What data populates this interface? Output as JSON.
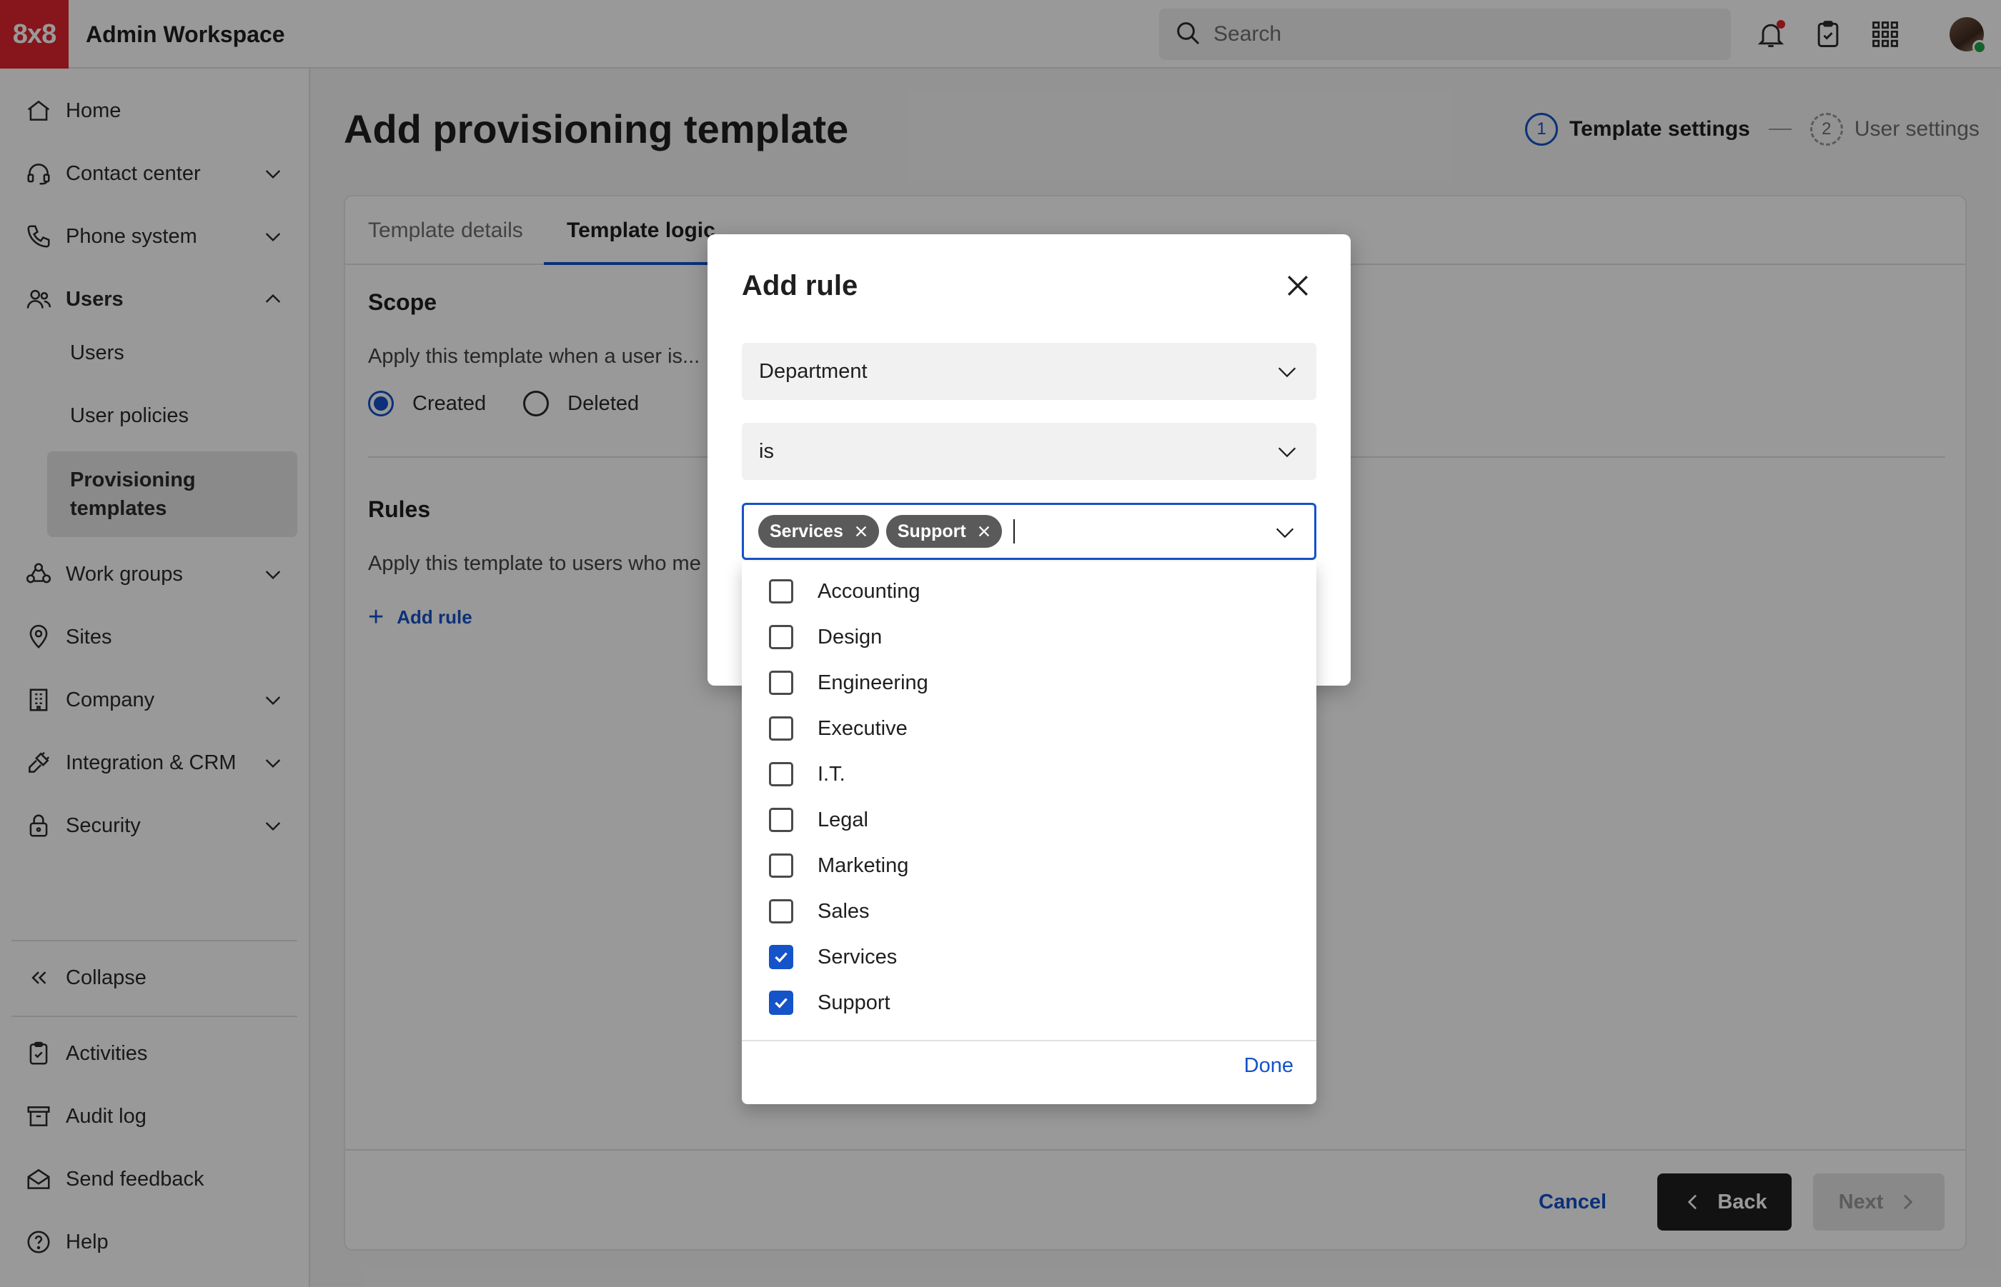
{
  "app": {
    "logo": "8x8",
    "title": "Admin Workspace"
  },
  "search": {
    "placeholder": "Search"
  },
  "sidebar": {
    "items": [
      {
        "label": "Home"
      },
      {
        "label": "Contact center"
      },
      {
        "label": "Phone system"
      },
      {
        "label": "Users"
      },
      {
        "label": "Work groups"
      },
      {
        "label": "Sites"
      },
      {
        "label": "Company"
      },
      {
        "label": "Integration & CRM"
      },
      {
        "label": "Security"
      }
    ],
    "users_sub": [
      {
        "label": "Users"
      },
      {
        "label": "User policies"
      },
      {
        "label": "Provisioning templates"
      }
    ],
    "bottom": [
      {
        "label": "Collapse"
      },
      {
        "label": "Activities"
      },
      {
        "label": "Audit log"
      },
      {
        "label": "Send feedback"
      },
      {
        "label": "Help"
      }
    ]
  },
  "page": {
    "title": "Add provisioning template",
    "steps": [
      {
        "number": "1",
        "label": "Template settings"
      },
      {
        "number": "2",
        "label": "User settings"
      }
    ],
    "tabs": [
      {
        "label": "Template details"
      },
      {
        "label": "Template logic"
      }
    ],
    "scope": {
      "title": "Scope",
      "text": "Apply this template when a user is...",
      "options": [
        {
          "label": "Created",
          "checked": true
        },
        {
          "label": "Deleted",
          "checked": false
        }
      ]
    },
    "rules": {
      "title": "Rules",
      "text": "Apply this template to users who me",
      "add_rule": "Add rule"
    },
    "footer": {
      "cancel": "Cancel",
      "back": "Back",
      "next": "Next"
    }
  },
  "modal": {
    "title": "Add rule",
    "field": {
      "value": "Department"
    },
    "operator": {
      "value": "is"
    },
    "chips": [
      {
        "label": "Services"
      },
      {
        "label": "Support"
      }
    ],
    "options": [
      {
        "label": "Accounting",
        "checked": false
      },
      {
        "label": "Design",
        "checked": false
      },
      {
        "label": "Engineering",
        "checked": false
      },
      {
        "label": "Executive",
        "checked": false
      },
      {
        "label": "I.T.",
        "checked": false
      },
      {
        "label": "Legal",
        "checked": false
      },
      {
        "label": "Marketing",
        "checked": false
      },
      {
        "label": "Sales",
        "checked": false
      },
      {
        "label": "Services",
        "checked": true
      },
      {
        "label": "Support",
        "checked": true
      }
    ],
    "done": "Done"
  },
  "colors": {
    "brand": "#e0242f",
    "accent": "#1553c8",
    "primary_button": "#1f1f1f"
  }
}
